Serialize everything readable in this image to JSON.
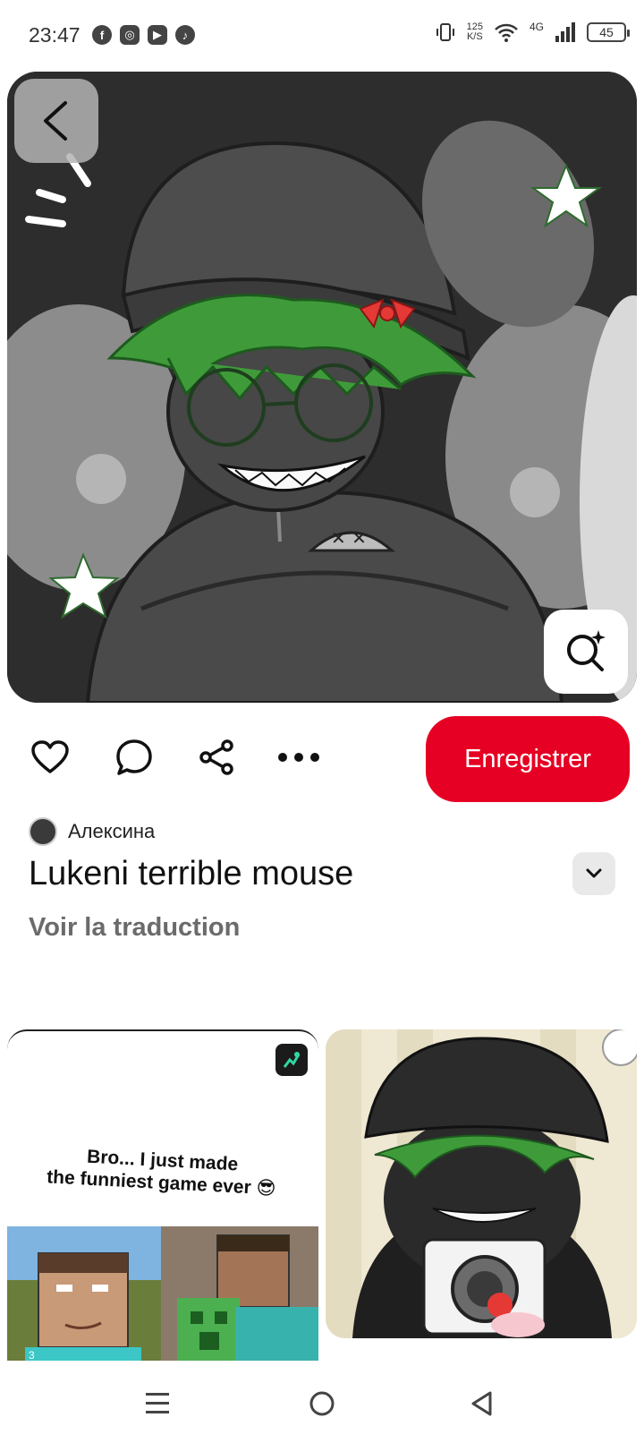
{
  "status_bar": {
    "time": "23:47",
    "net_speed_value": "125",
    "net_speed_unit": "K/S",
    "network": "4G",
    "battery": "45",
    "app_icons": [
      "facebook-icon",
      "instagram-icon",
      "youtube-icon",
      "music-icon"
    ]
  },
  "pin": {
    "author": "Алексина",
    "title": "Lukeni terrible mouse",
    "translate_link": "Voir la traduction",
    "save_label": "Enregistrer"
  },
  "related": {
    "left_card_text_line1": "Bro... I just made",
    "left_card_text_line2": "the funniest game ever 😎",
    "left_card_caption": "3"
  },
  "colors": {
    "accent": "#e60023",
    "hair_green": "#3f9b3a",
    "bow_red": "#e53935"
  }
}
